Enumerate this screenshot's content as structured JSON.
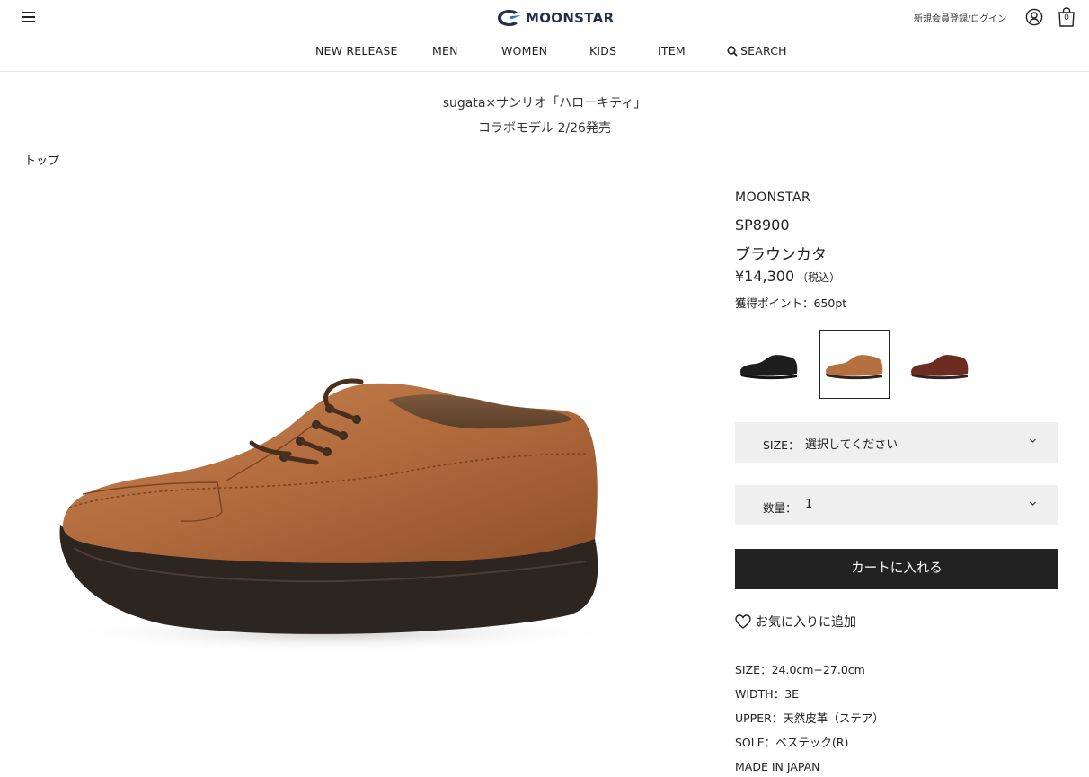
{
  "header": {
    "logo_text": "MOONSTAR",
    "login_link": "新規会員登録/ログイン",
    "cart_count": "0",
    "icons": [
      "hamburger-icon",
      "logo-icon",
      "user-icon",
      "cart-icon"
    ]
  },
  "nav": {
    "items": [
      {
        "label": "NEW RELEASE"
      },
      {
        "label": "MEN"
      },
      {
        "label": "WOMEN"
      },
      {
        "label": "KIDS"
      },
      {
        "label": "ITEM"
      },
      {
        "label": "SEARCH",
        "icon": "search-icon"
      }
    ]
  },
  "announcement": {
    "line1": "sugata×サンリオ「ハローキティ」",
    "line2": "コラボモデル 2/26発売"
  },
  "breadcrumb": {
    "top": "トップ"
  },
  "product": {
    "brand": "MOONSTAR",
    "model": "SP8900",
    "color": "ブラウンカタ",
    "price": "¥14,300",
    "price_tax": "（税込）",
    "points": "獲得ポイント：650pt",
    "swatches": [
      {
        "color": "#1d1d1d",
        "selected": false
      },
      {
        "color": "#b4703f",
        "selected": true
      },
      {
        "color": "#6c2c20",
        "selected": false
      }
    ],
    "size_select": {
      "label": "SIZE：",
      "value": "選択してください"
    },
    "qty_select": {
      "label": "数量：",
      "value": "1"
    },
    "add_to_cart": "カートに入れる",
    "favorite": "お気に入りに追加",
    "specs": [
      "SIZE：24.0cm−27.0cm",
      "WIDTH：3E",
      "UPPER：天然皮革（ステア）",
      "SOLE：ベステック(R)",
      "MADE IN JAPAN"
    ]
  },
  "colors": {
    "accent": "#222222",
    "select_bg": "#efefef",
    "logo_blue": "#23314f"
  }
}
